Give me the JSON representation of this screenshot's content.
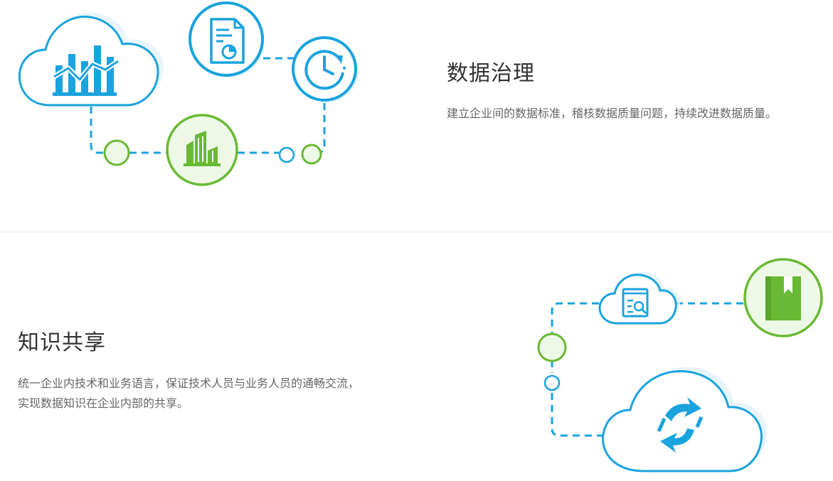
{
  "sections": [
    {
      "title": "数据治理",
      "description": "建立企业间的数据标准，稽核数据质量问题，持续改进数据质量。",
      "icons": [
        "cloud-chart-icon",
        "document-chart-icon",
        "clock-cycle-icon",
        "buildings-icon"
      ]
    },
    {
      "title": "知识共享",
      "description_lines": [
        "统一企业内技术和业务语言，保证技术人员与业务人员的通畅交流，",
        "实现数据知识在企业内部的共享。"
      ],
      "icons": [
        "cloud-search-icon",
        "book-icon",
        "cloud-sync-icon"
      ]
    }
  ],
  "colors": {
    "blue": "#1aa3dd",
    "green": "#6ab934",
    "green_fill": "#eef8e6",
    "title": "#333333",
    "text": "#666666",
    "divider": "#e4e4e4"
  }
}
